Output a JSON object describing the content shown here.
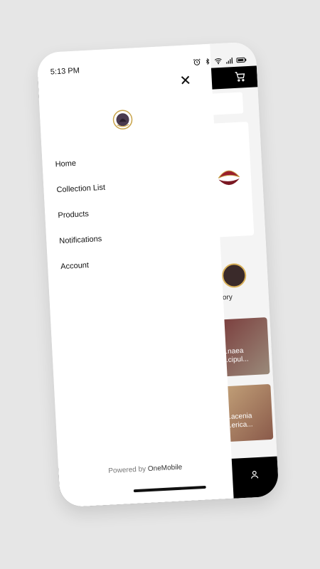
{
  "status_bar": {
    "time": "5:13 PM",
    "icons": [
      "alarm-icon",
      "bluetooth-icon",
      "wifi-icon",
      "signal-icon",
      "battery-icon"
    ]
  },
  "drawer": {
    "menu_items": [
      "Home",
      "Collection List",
      "Products",
      "Notifications",
      "Account"
    ],
    "powered_prefix": "Powered by",
    "powered_brand": "OneMobile"
  },
  "background_app": {
    "collection_label": "...tory\nte",
    "products": [
      {
        "name": "...naea\n...cipul..."
      },
      {
        "name": "...acenia\n...erica..."
      }
    ]
  },
  "colors": {
    "page_bg": "#e6e6e6",
    "drawer_bg": "#ffffff",
    "app_bar": "#000000"
  }
}
